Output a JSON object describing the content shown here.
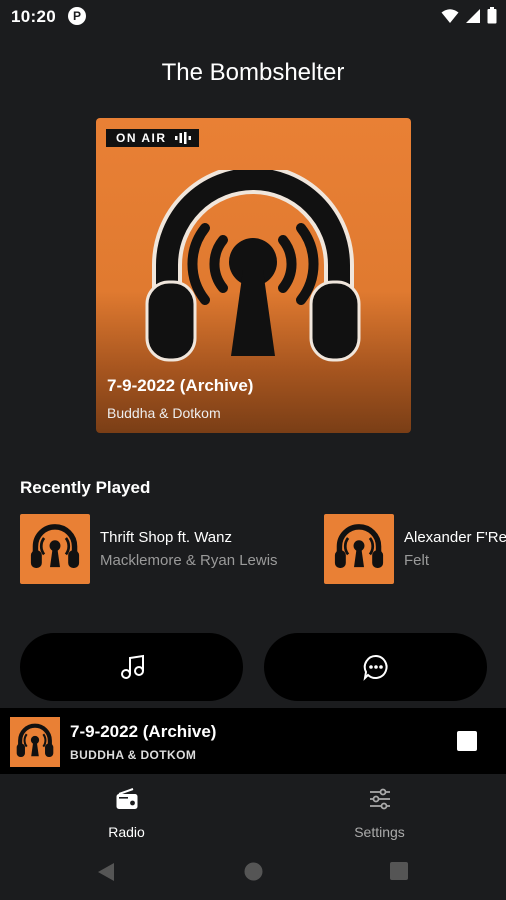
{
  "status_bar": {
    "time": "10:20",
    "app_icon_letter": "P"
  },
  "station": {
    "title": "The Bombshelter"
  },
  "now_playing": {
    "badge": "ON AIR",
    "title": "7-9-2022 (Archive)",
    "artist": "Buddha & Dotkom"
  },
  "recently_played": {
    "heading": "Recently Played",
    "items": [
      {
        "song": "Thrift Shop ft. Wanz",
        "artist": "Macklemore & Ryan Lewis"
      },
      {
        "song": "Alexander F'Re",
        "artist": "Felt"
      }
    ]
  },
  "actions": {
    "left_icon": "music-note-icon",
    "right_icon": "chat-icon"
  },
  "mini_player": {
    "title": "7-9-2022 (Archive)",
    "artist": "BUDDHA & DOTKOM"
  },
  "bottom_nav": {
    "items": [
      {
        "label": "Radio"
      },
      {
        "label": "Settings"
      }
    ]
  },
  "colors": {
    "accent": "#e98035",
    "background": "#1b1c1e",
    "surface": "#000000"
  }
}
